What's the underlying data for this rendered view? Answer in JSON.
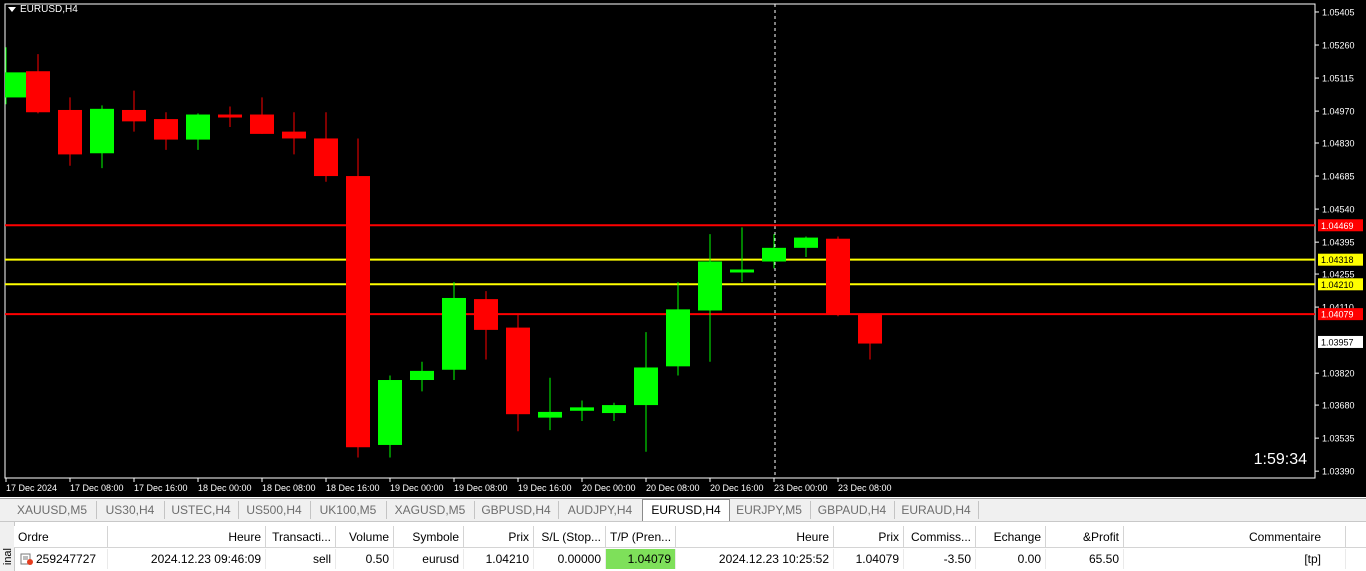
{
  "chart": {
    "title": "EURUSD,H4",
    "countdown": "1:59:34",
    "price_labels": [
      "1.05405",
      "1.05260",
      "1.05115",
      "1.04970",
      "1.04830",
      "1.04685",
      "1.04540",
      "1.04395",
      "1.04255",
      "1.04110",
      "1.03820",
      "1.03680",
      "1.03535",
      "1.03390"
    ],
    "level_labels": [
      {
        "price": 1.04469,
        "text": "1.04469",
        "color": "#ff0000",
        "text_color": "#ffffff"
      },
      {
        "price": 1.04318,
        "text": "1.04318",
        "color": "#ffff00",
        "text_color": "#000000"
      },
      {
        "price": 1.0421,
        "text": "1.04210",
        "color": "#ffff00",
        "text_color": "#000000"
      },
      {
        "price": 1.04079,
        "text": "1.04079",
        "color": "#ff0000",
        "text_color": "#ffffff"
      }
    ],
    "current_price": {
      "price": 1.03957,
      "text": "1.03957"
    },
    "time_labels": [
      "17 Dec 2024",
      "17 Dec 08:00",
      "17 Dec 16:00",
      "18 Dec 00:00",
      "18 Dec 08:00",
      "18 Dec 16:00",
      "19 Dec 00:00",
      "19 Dec 08:00",
      "19 Dec 16:00",
      "20 Dec 00:00",
      "20 Dec 08:00",
      "20 Dec 16:00",
      "23 Dec 00:00",
      "23 Dec 08:00"
    ],
    "colors": {
      "bull": "#00ff00",
      "bear": "#ff0000",
      "background": "#000000",
      "axis": "#ffffff"
    },
    "price_range": [
      1.0336,
      1.0544
    ],
    "candles": [
      {
        "o": 1.0503,
        "h": 1.0525,
        "l": 1.05,
        "c": 1.0514
      },
      {
        "o": 1.05145,
        "h": 1.0522,
        "l": 1.0496,
        "c": 1.04965
      },
      {
        "o": 1.04975,
        "h": 1.0503,
        "l": 1.0473,
        "c": 1.0478
      },
      {
        "o": 1.04785,
        "h": 1.04995,
        "l": 1.0472,
        "c": 1.0498
      },
      {
        "o": 1.04975,
        "h": 1.0506,
        "l": 1.0488,
        "c": 1.04925
      },
      {
        "o": 1.04935,
        "h": 1.04965,
        "l": 1.048,
        "c": 1.04845
      },
      {
        "o": 1.04845,
        "h": 1.0496,
        "l": 1.048,
        "c": 1.04955
      },
      {
        "o": 1.04955,
        "h": 1.0499,
        "l": 1.049,
        "c": 1.0495
      },
      {
        "o": 1.04955,
        "h": 1.0503,
        "l": 1.0487,
        "c": 1.0487
      },
      {
        "o": 1.0488,
        "h": 1.04965,
        "l": 1.0478,
        "c": 1.0485
      },
      {
        "o": 1.0485,
        "h": 1.04965,
        "l": 1.0466,
        "c": 1.04685
      },
      {
        "o": 1.04685,
        "h": 1.0485,
        "l": 1.0345,
        "c": 1.03495
      },
      {
        "o": 1.03505,
        "h": 1.0381,
        "l": 1.0345,
        "c": 1.0379
      },
      {
        "o": 1.0379,
        "h": 1.0387,
        "l": 1.0374,
        "c": 1.0383
      },
      {
        "o": 1.03835,
        "h": 1.0422,
        "l": 1.0379,
        "c": 1.0415
      },
      {
        "o": 1.04145,
        "h": 1.0418,
        "l": 1.0388,
        "c": 1.0401
      },
      {
        "o": 1.0402,
        "h": 1.0408,
        "l": 1.03565,
        "c": 1.0364
      },
      {
        "o": 1.03625,
        "h": 1.038,
        "l": 1.0357,
        "c": 1.0365
      },
      {
        "o": 1.03655,
        "h": 1.037,
        "l": 1.0361,
        "c": 1.0367
      },
      {
        "o": 1.03645,
        "h": 1.0369,
        "l": 1.0361,
        "c": 1.0368
      },
      {
        "o": 1.0368,
        "h": 1.04,
        "l": 1.03475,
        "c": 1.03845
      },
      {
        "o": 1.0385,
        "h": 1.0422,
        "l": 1.0381,
        "c": 1.041
      },
      {
        "o": 1.04095,
        "h": 1.0443,
        "l": 1.0387,
        "c": 1.0431
      },
      {
        "o": 1.0427,
        "h": 1.0446,
        "l": 1.0422,
        "c": 1.04275
      },
      {
        "o": 1.0431,
        "h": 1.0443,
        "l": 1.0428,
        "c": 1.0437
      },
      {
        "o": 1.0437,
        "h": 1.0442,
        "l": 1.0433,
        "c": 1.04415
      },
      {
        "o": 1.0441,
        "h": 1.0442,
        "l": 1.0407,
        "c": 1.0408
      },
      {
        "o": 1.0408,
        "h": 1.0408,
        "l": 1.0388,
        "c": 1.0395
      }
    ]
  },
  "tabs": [
    "XAUUSD,M5",
    "US30,H4",
    "USTEC,H4",
    "US500,H4",
    "UK100,M5",
    "XAGUSD,M5",
    "GBPUSD,H4",
    "AUDJPY,H4",
    "EURUSD,H4",
    "EURJPY,M5",
    "GBPAUD,H4",
    "EURAUD,H4"
  ],
  "active_tab": "EURUSD,H4",
  "terminal": {
    "side_label": "inal",
    "headers": {
      "order": "Ordre",
      "time": "Heure",
      "type": "Transacti...",
      "volume": "Volume",
      "symbol": "Symbole",
      "price": "Prix",
      "sl": "S/L (Stop...",
      "tp": "T/P (Pren...",
      "time2": "Heure",
      "price2": "Prix",
      "commission": "Commiss...",
      "swap": "Echange",
      "profit": "&Profit",
      "comment": "Commentaire"
    },
    "row": {
      "order": "259247727",
      "time": "2024.12.23 09:46:09",
      "type": "sell",
      "volume": "0.50",
      "symbol": "eurusd",
      "price": "1.04210",
      "sl": "0.00000",
      "tp": "1.04079",
      "time2": "2024.12.23 10:25:52",
      "price2": "1.04079",
      "commission": "-3.50",
      "swap": "0.00",
      "profit": "65.50",
      "comment": "[tp]"
    }
  }
}
